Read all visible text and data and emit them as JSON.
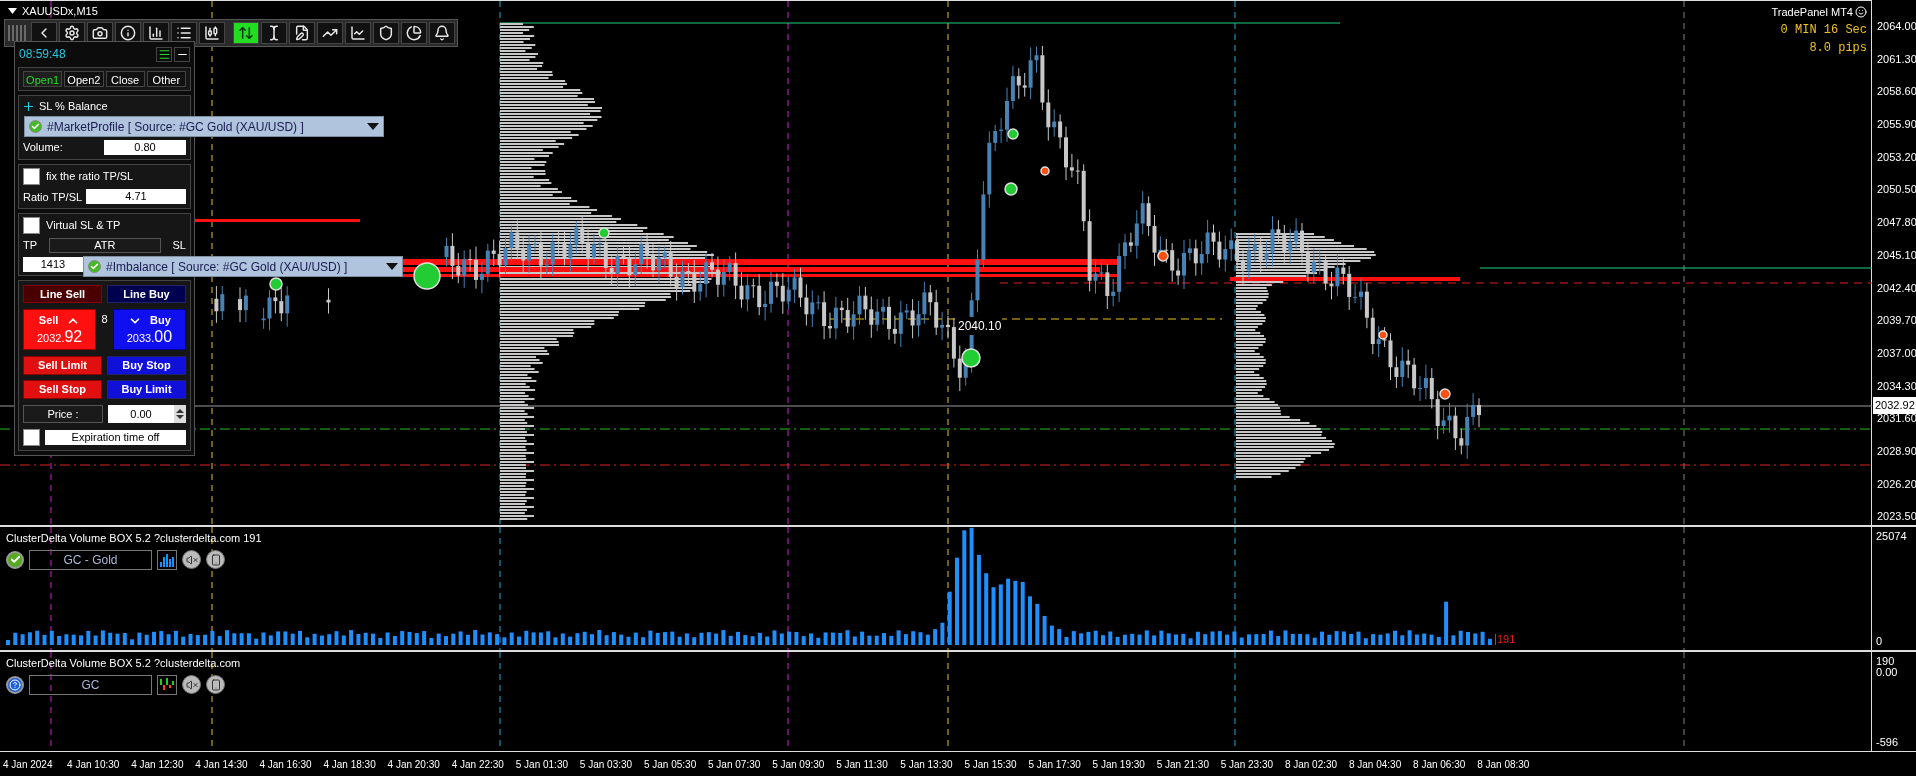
{
  "chart_title": "XAUUSDx,M15",
  "toolbar": {
    "buttons": [
      {
        "selected": false
      },
      {
        "selected": false
      },
      {
        "selected": false
      },
      {
        "selected": false
      },
      {
        "selected": false
      },
      {
        "selected": false
      },
      {
        "selected": false
      },
      {
        "selected": true
      },
      {
        "selected": false
      },
      {
        "selected": false
      },
      {
        "selected": false
      },
      {
        "selected": false
      },
      {
        "selected": false
      },
      {
        "selected": false
      },
      {
        "selected": false
      }
    ]
  },
  "trade_panel": {
    "clock": "08:59:48",
    "tabs": [
      {
        "label": "Open1",
        "selected": true
      },
      {
        "label": "Open2",
        "selected": false
      },
      {
        "label": "Close",
        "selected": false
      },
      {
        "label": "Other",
        "selected": false
      }
    ],
    "sl_section": {
      "label": "SL % Balance"
    },
    "volume": {
      "label": "Volume:",
      "value": "0.80"
    },
    "fix_ratio": {
      "label": "fix the ratio TP/SL",
      "checked": false
    },
    "ratio": {
      "label": "Ratio TP/SL",
      "value": "4.71"
    },
    "virtual": {
      "label": "Virtual SL & TP",
      "checked": false
    },
    "tp_label": "TP",
    "atr_label": "ATR",
    "sl_label": "SL",
    "atr_value": "1413",
    "line_buttons": [
      "Line Sell",
      "Line Buy"
    ],
    "sell": {
      "label": "Sell",
      "price_int": "2032.",
      "price_frac": "92"
    },
    "spread": "8",
    "buy": {
      "label": "Buy",
      "price_int": "2033.",
      "price_frac": "00"
    },
    "order_buttons": [
      {
        "label": "Sell Limit",
        "kind": "sell"
      },
      {
        "label": "Buy Stop",
        "kind": "buy"
      },
      {
        "label": "Sell Stop",
        "kind": "sell"
      },
      {
        "label": "Buy Limit",
        "kind": "buy"
      }
    ],
    "price": {
      "label": "Price :",
      "value": "0.00"
    },
    "expiration": {
      "label": "Expiration time off",
      "checked": false
    }
  },
  "overlays": [
    {
      "text": "#MarketProfile [ Source: #GC Gold (XAU/USD) ]"
    },
    {
      "text": "#Imbalance [ Source: #GC Gold (XAU/USD) ]"
    }
  ],
  "chart_labels": [
    {
      "text": "2040.10"
    }
  ],
  "info": {
    "title": "TradePanel MT4",
    "timer": "0 MIN 16 Sec",
    "pips": "8.0 pips"
  },
  "price_axis": {
    "labels": [
      "2064.00",
      "2061.30",
      "2058.60",
      "2055.90",
      "2053.20",
      "2050.50",
      "2047.80",
      "2045.10",
      "2042.40",
      "2039.70",
      "2037.00",
      "2034.30",
      "2031.60",
      "2028.90",
      "2026.20",
      "2023.50"
    ],
    "current": "2032.92"
  },
  "indicators": [
    {
      "title": "ClusterDelta Volume BOX 5.2 ?clusterdelta.com 191",
      "kind": "volume",
      "symbol": "GC - Gold",
      "axis": [
        "25074",
        "0"
      ],
      "last_value": "191"
    },
    {
      "title": "ClusterDelta Volume BOX 5.2 ?clusterdelta.com",
      "kind": "delta",
      "symbol": "GC",
      "axis": [
        "190",
        "0.00",
        "-596"
      ]
    }
  ],
  "time_axis": [
    "4 Jan 2024",
    "4 Jan 10:30",
    "4 Jan 12:30",
    "4 Jan 14:30",
    "4 Jan 16:30",
    "4 Jan 18:30",
    "4 Jan 20:30",
    "4 Jan 22:30",
    "5 Jan 01:30",
    "5 Jan 03:30",
    "5 Jan 05:30",
    "5 Jan 07:30",
    "5 Jan 09:30",
    "5 Jan 11:30",
    "5 Jan 13:30",
    "5 Jan 15:30",
    "5 Jan 17:30",
    "5 Jan 19:30",
    "5 Jan 21:30",
    "5 Jan 23:30",
    "8 Jan 02:30",
    "8 Jan 04:30",
    "8 Jan 06:30",
    "8 Jan 08:30"
  ]
}
